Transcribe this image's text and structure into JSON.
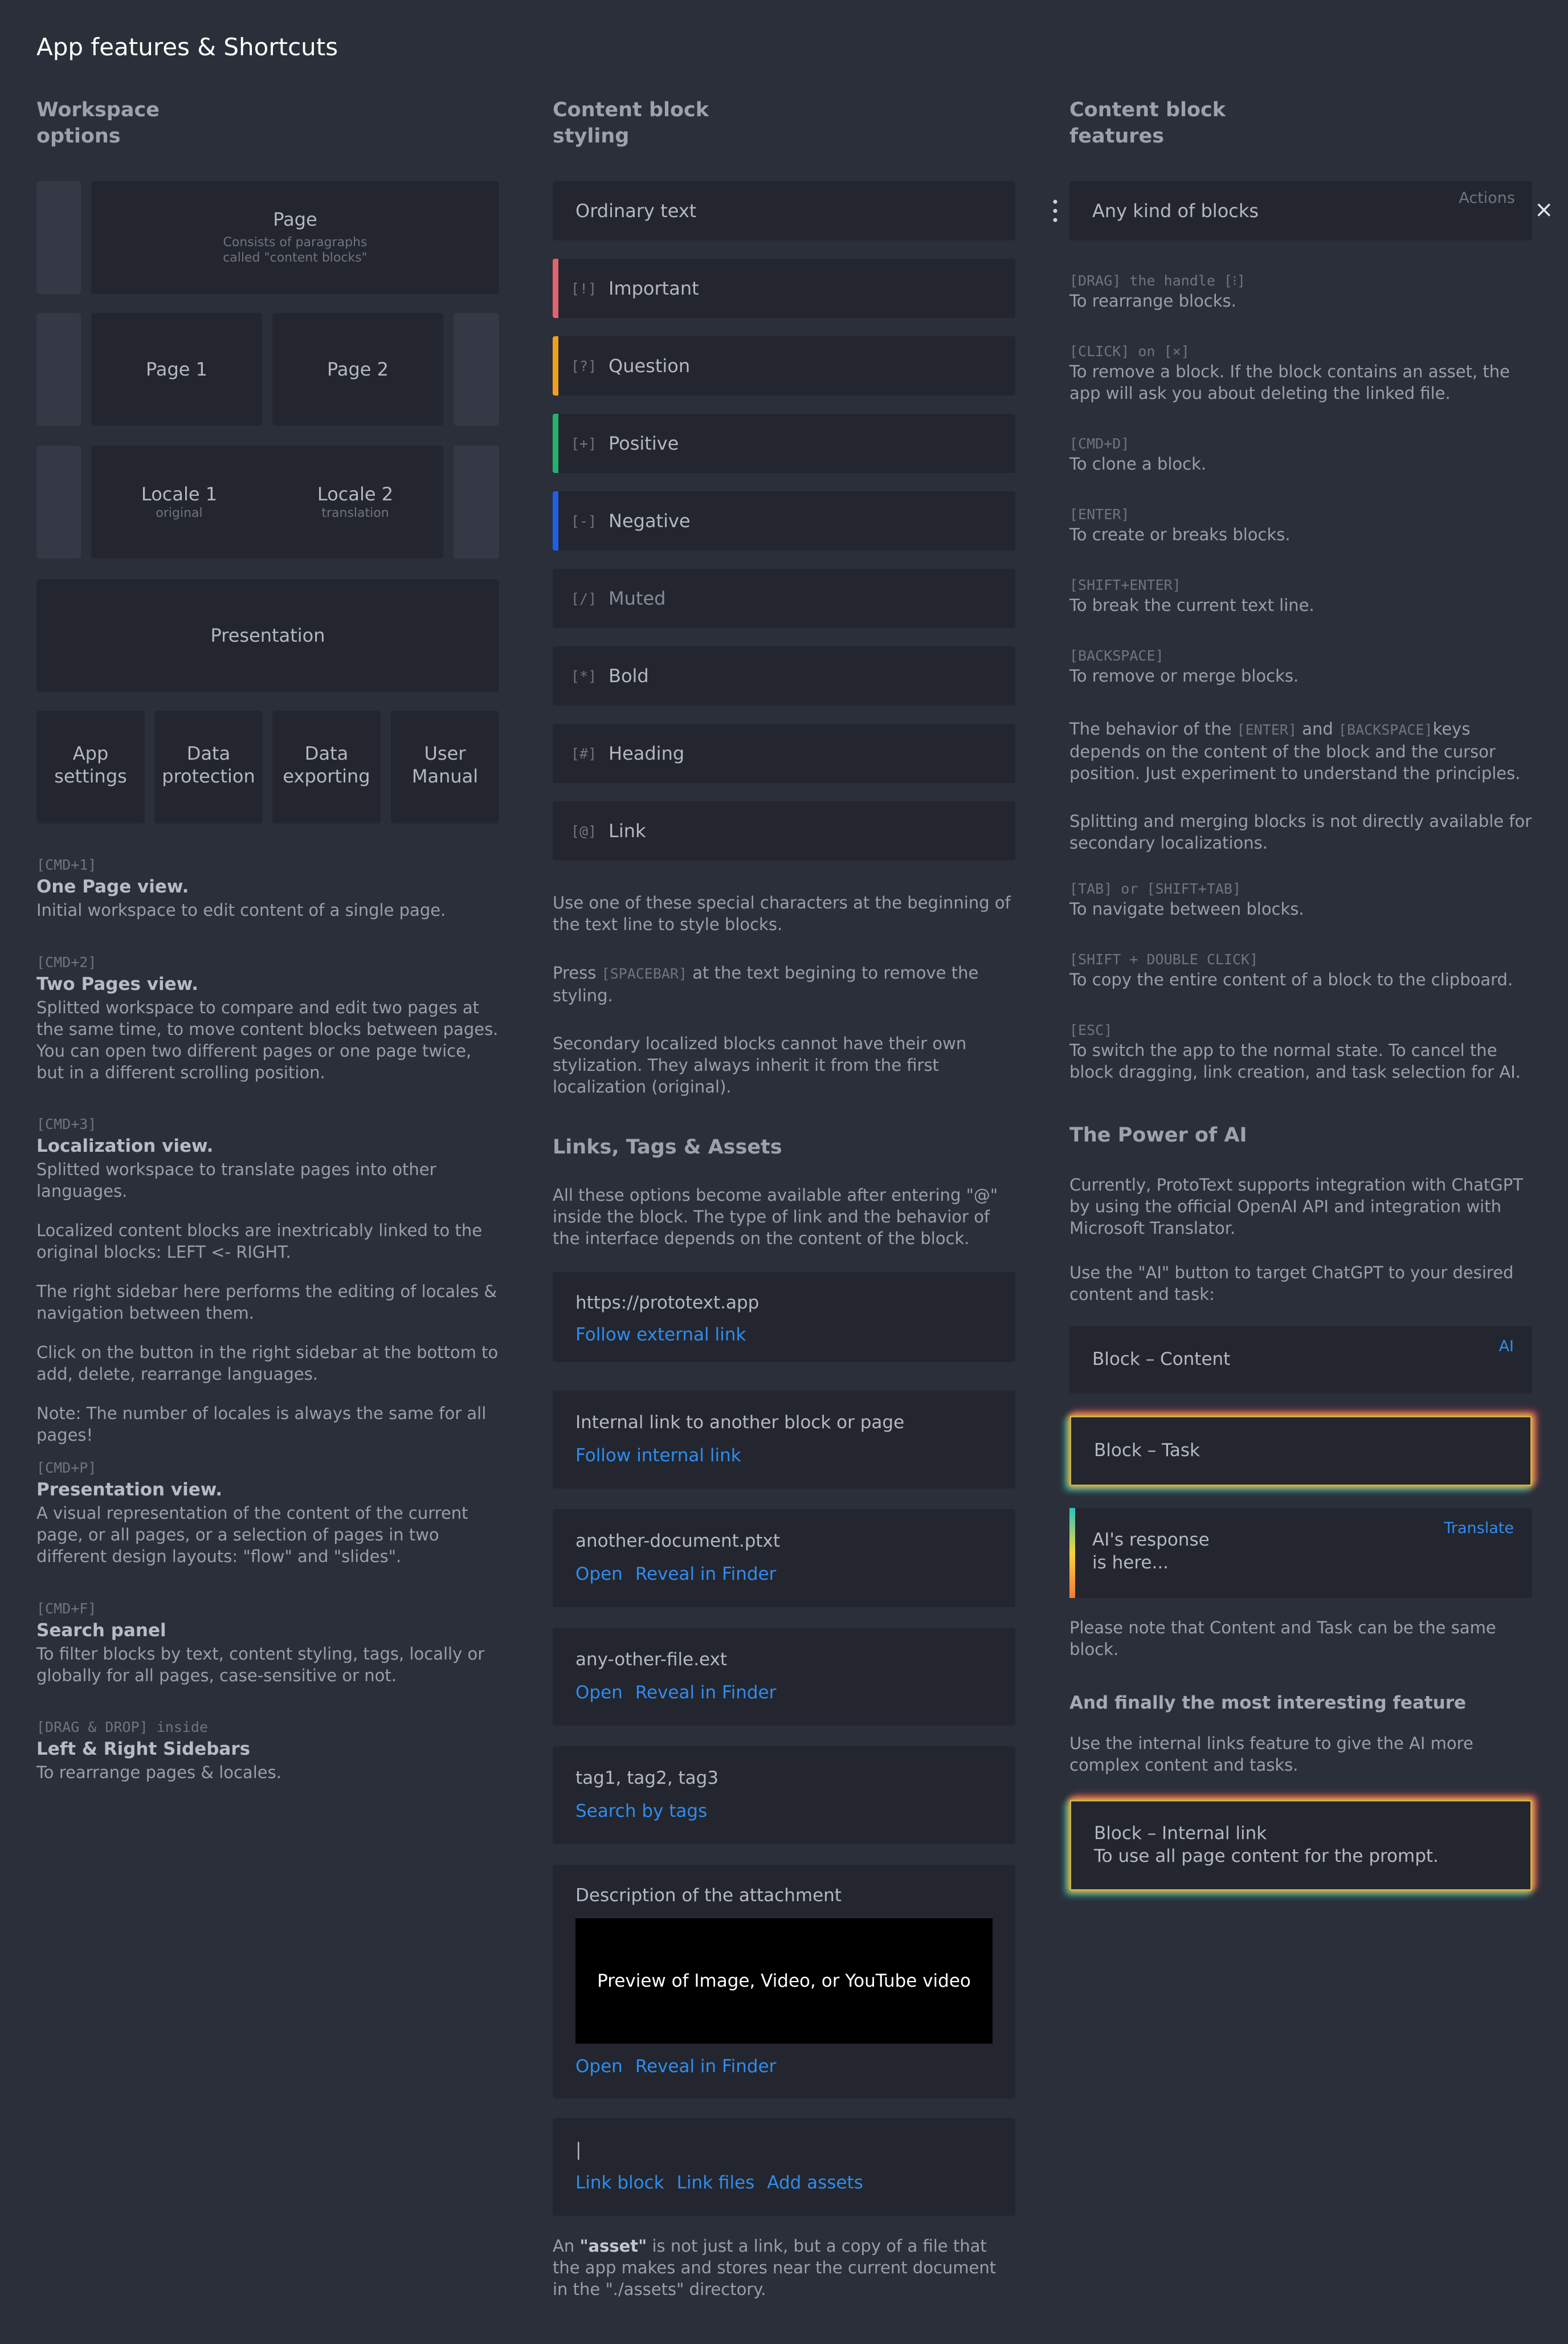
{
  "title": "App features & Shortcuts",
  "col1": {
    "heading": "Workspace\noptions",
    "page": {
      "label": "Page",
      "sub1": "Consists of paragraphs",
      "sub2": "called \"content blocks\""
    },
    "page1": "Page 1",
    "page2": "Page 2",
    "locale1": {
      "label": "Locale 1",
      "sub": "original"
    },
    "locale2": {
      "label": "Locale 2",
      "sub": "translation"
    },
    "presentation": "Presentation",
    "tiles": [
      {
        "l1": "App",
        "l2": "settings"
      },
      {
        "l1": "Data",
        "l2": "protection"
      },
      {
        "l1": "Data",
        "l2": "exporting"
      },
      {
        "l1": "User",
        "l2": "Manual"
      }
    ],
    "shortcuts": [
      {
        "key": "[CMD+1]",
        "title": "One Page view.",
        "paras": [
          "Initial workspace to edit content of a single page."
        ]
      },
      {
        "key": "[CMD+2]",
        "title": "Two Pages view.",
        "paras": [
          "Splitted workspace to compare and edit two pages at the same time, to move content blocks between pages. You can open two different pages or one page twice, but in a different scrolling position."
        ]
      },
      {
        "key": "[CMD+3]",
        "title": "Localization view.",
        "paras": [
          "Splitted workspace to translate pages into other languages.",
          "Localized content blocks are inextricably linked to the original blocks: LEFT <- RIGHT.",
          "The right sidebar here performs the editing of locales & navigation between them.",
          "Click on the button in the right sidebar at the bottom to add, delete, rearrange languages.",
          "Note: The number of locales is always the same for all pages!"
        ]
      },
      {
        "key": "[CMD+P]",
        "title": "Presentation view.",
        "paras": [
          "A visual representation of the content of the current page, or all pages, or a selection of pages in two different design layouts: \"flow\" and \"slides\"."
        ]
      },
      {
        "key": "[CMD+F]",
        "title": "Search panel",
        "paras": [
          "To filter blocks by text, content styling, tags, locally or globally for all pages, case-sensitive or not."
        ]
      },
      {
        "key": "[DRAG & DROP] inside",
        "title": "Left & Right Sidebars",
        "paras": [
          "To rearrange pages & locales."
        ]
      }
    ]
  },
  "col2": {
    "heading": "Content block\nstyling",
    "ordinary": "Ordinary text",
    "styles": [
      {
        "mark": "[!]",
        "label": "Important",
        "color": "#e0636f"
      },
      {
        "mark": "[?]",
        "label": "Question",
        "color": "#f0a020"
      },
      {
        "mark": "[+]",
        "label": "Positive",
        "color": "#22b36b"
      },
      {
        "mark": "[-]",
        "label": "Negative",
        "color": "#1f5fe8"
      },
      {
        "mark": "[/]",
        "label": "Muted",
        "color": ""
      },
      {
        "mark": "[*]",
        "label": "Bold",
        "color": ""
      },
      {
        "mark": "[#]",
        "label": "Heading",
        "color": ""
      },
      {
        "mark": "[@]",
        "label": "Link",
        "color": ""
      }
    ],
    "note1": "Use one of these special characters at the beginning of the text line to style blocks.",
    "note2_pre": "Press ",
    "note2_key": "[SPACEBAR]",
    "note2_post": " at the text begining to remove the styling.",
    "note3": "Secondary localized blocks cannot have their own stylization. They always inherit it from the first localization (original).",
    "links_heading": "Links, Tags & Assets",
    "links_intro": "All these options become available after entering \"@\" inside the block. The type of link and the behavior of the interface depends on the content of the block.",
    "cards": [
      {
        "text": "https://prototext.app",
        "links": [
          "Follow external link"
        ]
      },
      {
        "text": "Internal link to another block or page",
        "links": [
          "Follow internal link"
        ]
      },
      {
        "text": "another-document.ptxt",
        "links": [
          "Open",
          "Reveal in Finder"
        ]
      },
      {
        "text": "any-other-file.ext",
        "links": [
          "Open",
          "Reveal in Finder"
        ]
      },
      {
        "text": "tag1, tag2, tag3",
        "links": [
          "Search by tags"
        ]
      }
    ],
    "attachment": {
      "text": "Description of the attachment",
      "preview": "Preview of Image, Video, or YouTube video",
      "links": [
        "Open",
        "Reveal in Finder"
      ]
    },
    "cursor_card": {
      "text": "|",
      "links": [
        "Link block",
        "Link files",
        "Add assets"
      ]
    },
    "asset_pre": "An ",
    "asset_bold": "\"asset\"",
    "asset_post": " is not just a link, but a copy of a file that the app makes and stores near the current document in the \"./assets\" directory."
  },
  "col3": {
    "heading": "Content block\nfeatures",
    "block_text": "Any kind of blocks",
    "actions": "Actions",
    "close": "×",
    "features": [
      {
        "key": "[DRAG] the handle [⁝]",
        "text": "To rearrange blocks."
      },
      {
        "key": "[CLICK] on [×]",
        "text": "To remove a block. If the block contains an asset, the app will ask you about deleting the linked file."
      },
      {
        "key": "[CMD+D]",
        "text": "To clone a block."
      },
      {
        "key": "[ENTER]",
        "text": "To create or breaks blocks."
      },
      {
        "key": "[SHIFT+ENTER]",
        "text": "To break the current text line."
      },
      {
        "key": "[BACKSPACE]",
        "text": "To remove or merge blocks."
      }
    ],
    "behavior_pre": "The behavior of the ",
    "behavior_k1": "[ENTER]",
    "behavior_mid": " and ",
    "behavior_k2": "[BACKSPACE]",
    "behavior_post": "keys depends on the content of the block and the cursor position. Just experiment to understand the principles.",
    "splitting": "Splitting and merging blocks is not directly available for secondary localizations.",
    "features2": [
      {
        "key": "[TAB] or [SHIFT+TAB]",
        "text": "To navigate between blocks."
      },
      {
        "key": "[SHIFT + DOUBLE CLICK]",
        "text": "To copy the entire content of a block to the clipboard."
      },
      {
        "key": "[ESC]",
        "text": "To switch the app to the normal state. To cancel the block dragging, link creation, and task selection for AI."
      }
    ],
    "ai_heading": "The Power of AI",
    "ai_p1": "Currently, ProtoText supports integration with ChatGPT by using the official OpenAI API and integration with Microsoft Translator.",
    "ai_p2": "Use the \"AI\" button to target ChatGPT to your desired content and task:",
    "block_content": "Block – Content",
    "ai_btn": "AI",
    "block_task": "Block – Task",
    "response_l1": "AI's response",
    "response_l2": "is here...",
    "translate": "Translate",
    "note_same": "Please note that Content and Task can be the same block.",
    "finally": "And finally the most interesting feature",
    "finally_p": "Use the internal links feature to give the AI more complex content and tasks.",
    "internal_l1": "Block – Internal link",
    "internal_l2": "To use all page content for the prompt."
  }
}
